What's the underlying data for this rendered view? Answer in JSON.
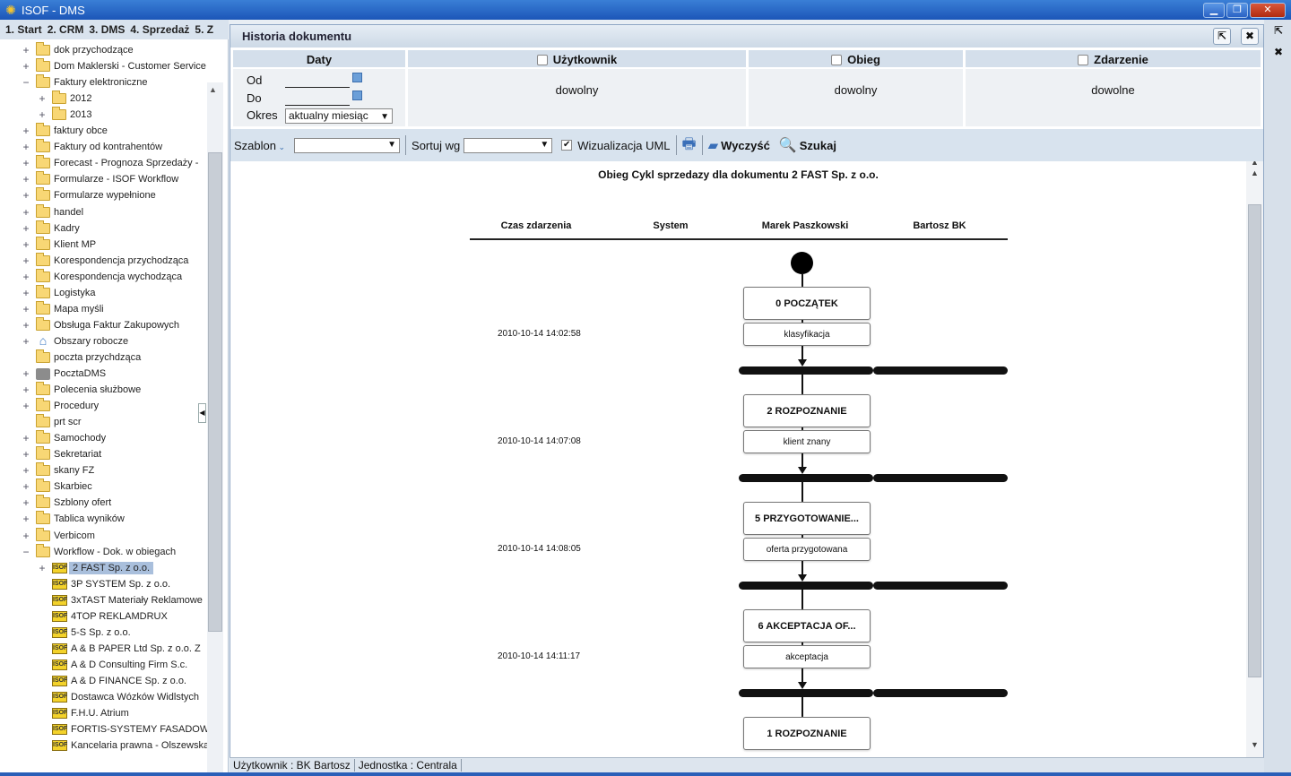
{
  "app": {
    "title": "ISOF - DMS"
  },
  "window_buttons": {
    "minimize": "▁",
    "restore": "❐",
    "close": "✕"
  },
  "menu": [
    "1. Start",
    "2. CRM",
    "3. DMS",
    "4. Sprzedaż",
    "5. Z"
  ],
  "tree": [
    {
      "label": "dok przychodzące",
      "exp": "+",
      "icon": "folder",
      "level": 0
    },
    {
      "label": "Dom Maklerski - Customer Service",
      "exp": "+",
      "icon": "folder",
      "level": 0
    },
    {
      "label": "Faktury elektroniczne",
      "exp": "−",
      "icon": "folder",
      "level": 0
    },
    {
      "label": "2012",
      "exp": "+",
      "icon": "folder",
      "level": 1
    },
    {
      "label": "2013",
      "exp": "+",
      "icon": "folder",
      "level": 1
    },
    {
      "label": "faktury obce",
      "exp": "+",
      "icon": "folder",
      "level": 0
    },
    {
      "label": "Faktury od kontrahentów",
      "exp": "+",
      "icon": "folder",
      "level": 0
    },
    {
      "label": "Forecast - Prognoza Sprzedaży -",
      "exp": "+",
      "icon": "folder",
      "level": 0
    },
    {
      "label": "Formularze - ISOF Workflow",
      "exp": "+",
      "icon": "folder",
      "level": 0
    },
    {
      "label": "Formularze wypełnione",
      "exp": "+",
      "icon": "folder",
      "level": 0
    },
    {
      "label": "handel",
      "exp": "+",
      "icon": "folder",
      "level": 0
    },
    {
      "label": "Kadry",
      "exp": "+",
      "icon": "folder",
      "level": 0
    },
    {
      "label": "Klient MP",
      "exp": "+",
      "icon": "folder",
      "level": 0
    },
    {
      "label": "Korespondencja przychodząca",
      "exp": "+",
      "icon": "folder",
      "level": 0
    },
    {
      "label": "Korespondencja wychodząca",
      "exp": "+",
      "icon": "folder",
      "level": 0
    },
    {
      "label": "Logistyka",
      "exp": "+",
      "icon": "folder",
      "level": 0
    },
    {
      "label": "Mapa myśli",
      "exp": "+",
      "icon": "folder",
      "level": 0
    },
    {
      "label": "Obsługa Faktur Zakupowych",
      "exp": "+",
      "icon": "folder",
      "level": 0
    },
    {
      "label": "Obszary robocze",
      "exp": "+",
      "icon": "house",
      "level": 0
    },
    {
      "label": "poczta przychdząca",
      "exp": "",
      "icon": "folder",
      "level": 0
    },
    {
      "label": "PocztaDMS",
      "exp": "+",
      "icon": "mail",
      "level": 0
    },
    {
      "label": "Polecenia służbowe",
      "exp": "+",
      "icon": "folder",
      "level": 0
    },
    {
      "label": "Procedury",
      "exp": "+",
      "icon": "folder",
      "level": 0
    },
    {
      "label": "prt scr",
      "exp": "",
      "icon": "folder",
      "level": 0
    },
    {
      "label": "Samochody",
      "exp": "+",
      "icon": "folder",
      "level": 0
    },
    {
      "label": "Sekretariat",
      "exp": "+",
      "icon": "folder",
      "level": 0
    },
    {
      "label": "skany FZ",
      "exp": "+",
      "icon": "folder",
      "level": 0
    },
    {
      "label": "Skarbiec",
      "exp": "+",
      "icon": "folder",
      "level": 0
    },
    {
      "label": "Szblony ofert",
      "exp": "+",
      "icon": "folder",
      "level": 0
    },
    {
      "label": "Tablica wyników",
      "exp": "+",
      "icon": "folder",
      "level": 0
    },
    {
      "label": "Verbicom",
      "exp": "+",
      "icon": "folder",
      "level": 0
    },
    {
      "label": "Workflow - Dok. w obiegach",
      "exp": "−",
      "icon": "folder",
      "level": 0
    },
    {
      "label": "2 FAST Sp. z o.o.",
      "exp": "+",
      "icon": "isof",
      "level": 1,
      "selected": true
    },
    {
      "label": "3P SYSTEM Sp. z o.o.",
      "exp": "",
      "icon": "isof",
      "level": 1
    },
    {
      "label": "3xTAST Materiały Reklamowe",
      "exp": "",
      "icon": "isof",
      "level": 1
    },
    {
      "label": "4TOP REKLAMDRUX",
      "exp": "",
      "icon": "isof",
      "level": 1
    },
    {
      "label": "5-S Sp. z o.o.",
      "exp": "",
      "icon": "isof",
      "level": 1
    },
    {
      "label": "A & B PAPER Ltd Sp. z o.o. Z",
      "exp": "",
      "icon": "isof",
      "level": 1
    },
    {
      "label": "A & D Consulting Firm S.c.",
      "exp": "",
      "icon": "isof",
      "level": 1
    },
    {
      "label": "A & D FINANCE Sp. z o.o.",
      "exp": "",
      "icon": "isof",
      "level": 1
    },
    {
      "label": "Dostawca Wózków Widlstych",
      "exp": "",
      "icon": "isof",
      "level": 1
    },
    {
      "label": "F.H.U. Atrium",
      "exp": "",
      "icon": "isof",
      "level": 1
    },
    {
      "label": "FORTIS-SYSTEMY FASADOWI",
      "exp": "",
      "icon": "isof",
      "level": 1
    },
    {
      "label": "Kancelaria prawna - Olszewska",
      "exp": "",
      "icon": "isof",
      "level": 1
    }
  ],
  "dialog": {
    "title": "Historia dokumentu",
    "filters": {
      "daty_label": "Daty",
      "od_label": "Od",
      "do_label": "Do",
      "okres_label": "Okres",
      "okres_value": "aktualny miesiąc",
      "uzytkownik_label": "Użytkownik",
      "uzytkownik_value": "dowolny",
      "obieg_label": "Obieg",
      "obieg_value": "dowolny",
      "zdarzenie_label": "Zdarzenie",
      "zdarzenie_value": "dowolne"
    },
    "toolbar": {
      "szablon_label": "Szablon",
      "sortuj_label": "Sortuj wg",
      "wizualizacja_label": "Wizualizacja UML",
      "wizualizacja_checked": true,
      "wyczysc_label": "Wyczyść",
      "szukaj_label": "Szukaj"
    },
    "diagram": {
      "title": "Obieg Cykl sprzedazy dla dokumentu 2 FAST Sp. z o.o.",
      "columns": [
        "Czas zdarzenia",
        "System",
        "Marek Paszkowski",
        "Bartosz BK"
      ],
      "steps": [
        {
          "state": "0 POCZĄTEK",
          "action": "klasyfikacja",
          "time": "2010-10-14 14:02:58"
        },
        {
          "state": "2 ROZPOZNANIE",
          "action": "klient znany",
          "time": "2010-10-14 14:07:08"
        },
        {
          "state": "5 PRZYGOTOWANIE...",
          "action": "oferta przygotowana",
          "time": "2010-10-14 14:08:05"
        },
        {
          "state": "6 AKCEPTACJA OF...",
          "action": "akceptacja",
          "time": "2010-10-14 14:11:17"
        },
        {
          "state": "1 ROZPOZNANIE",
          "action": "",
          "time": ""
        }
      ]
    }
  },
  "status": {
    "user": "Użytkownik : BK Bartosz",
    "unit": "Jednostka : Centrala"
  }
}
